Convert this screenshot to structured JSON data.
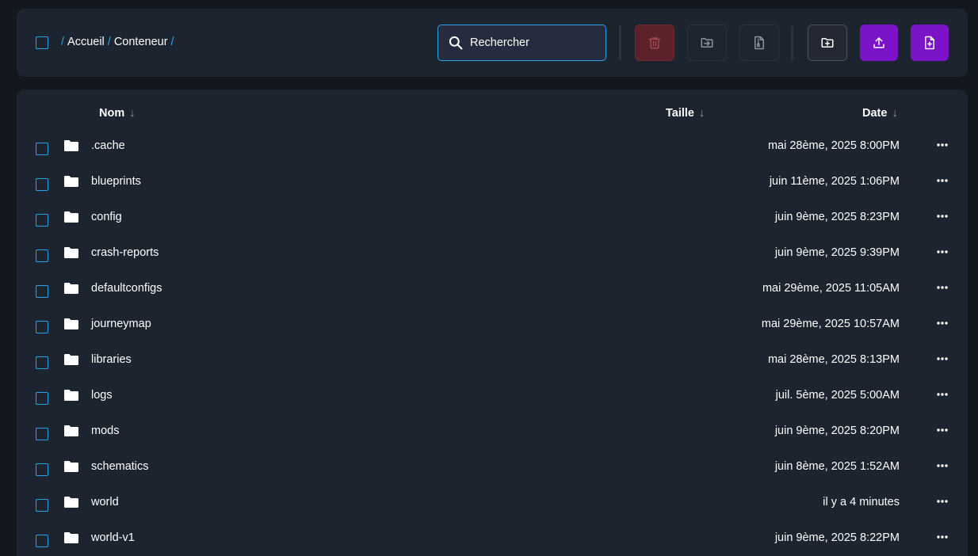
{
  "breadcrumb": {
    "separator": "/",
    "parts": [
      "Accueil",
      "Conteneur"
    ]
  },
  "search": {
    "placeholder": "Rechercher",
    "value": ""
  },
  "toolbar": {
    "delete_icon": "trash-icon",
    "move_icon": "move-to-folder-icon",
    "compress_icon": "file-archive-icon",
    "new_folder_icon": "folder-plus-icon",
    "upload_icon": "upload-icon",
    "new_file_icon": "file-plus-icon"
  },
  "table": {
    "headers": {
      "name": "Nom",
      "size": "Taille",
      "date": "Date",
      "sort_glyph": "↓"
    },
    "rows": [
      {
        "name": ".cache",
        "date": "mai 28ème, 2025 8:00PM"
      },
      {
        "name": "blueprints",
        "date": "juin 11ème, 2025 1:06PM"
      },
      {
        "name": "config",
        "date": "juin 9ème, 2025 8:23PM"
      },
      {
        "name": "crash-reports",
        "date": "juin 9ème, 2025 9:39PM"
      },
      {
        "name": "defaultconfigs",
        "date": "mai 29ème, 2025 11:05AM"
      },
      {
        "name": "journeymap",
        "date": "mai 29ème, 2025 10:57AM"
      },
      {
        "name": "libraries",
        "date": "mai 28ème, 2025 8:13PM"
      },
      {
        "name": "logs",
        "date": "juil. 5ème, 2025 5:00AM"
      },
      {
        "name": "mods",
        "date": "juin 9ème, 2025 8:20PM"
      },
      {
        "name": "schematics",
        "date": "juin 8ème, 2025 1:52AM"
      },
      {
        "name": "world",
        "date": "il y a 4 minutes"
      },
      {
        "name": "world-v1",
        "date": "juin 9ème, 2025 8:22PM"
      }
    ]
  },
  "colors": {
    "background": "#13181f",
    "panel": "#1c242f",
    "accent": "#29a3e6",
    "primary": "#7b14c8",
    "danger": "#5c2229"
  }
}
